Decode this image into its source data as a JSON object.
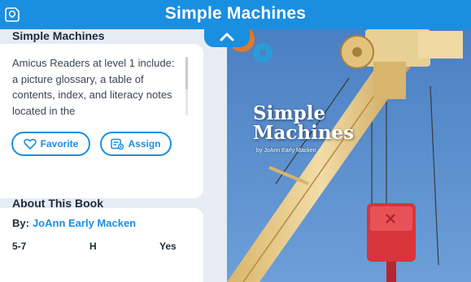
{
  "header": {
    "title": "Simple Machines",
    "app_icon": "lightbulb-badge-icon",
    "bg_color": "#1a8fe0"
  },
  "summary_card": {
    "title": "Simple Machines",
    "description": "Amicus Readers at level 1 include: a picture glossary, a table of contents, index, and literacy notes located in the",
    "favorite_label": "Favorite",
    "favorite_icon": "heart-icon",
    "assign_label": "Assign",
    "assign_icon": "assign-clipboard-icon"
  },
  "about_card": {
    "title": "About This Book",
    "by_label": "By:",
    "author": "JoAnn Early Macken",
    "meta": [
      "5-7",
      "H",
      "Yes"
    ]
  },
  "cover": {
    "title_line1": "Simple",
    "title_line2": "Machines",
    "byline": "by JoAnn Early Macken"
  },
  "colors": {
    "accent": "#1a8fe0",
    "page_bg": "#e6ecf4",
    "sky": "#4f86c9"
  }
}
